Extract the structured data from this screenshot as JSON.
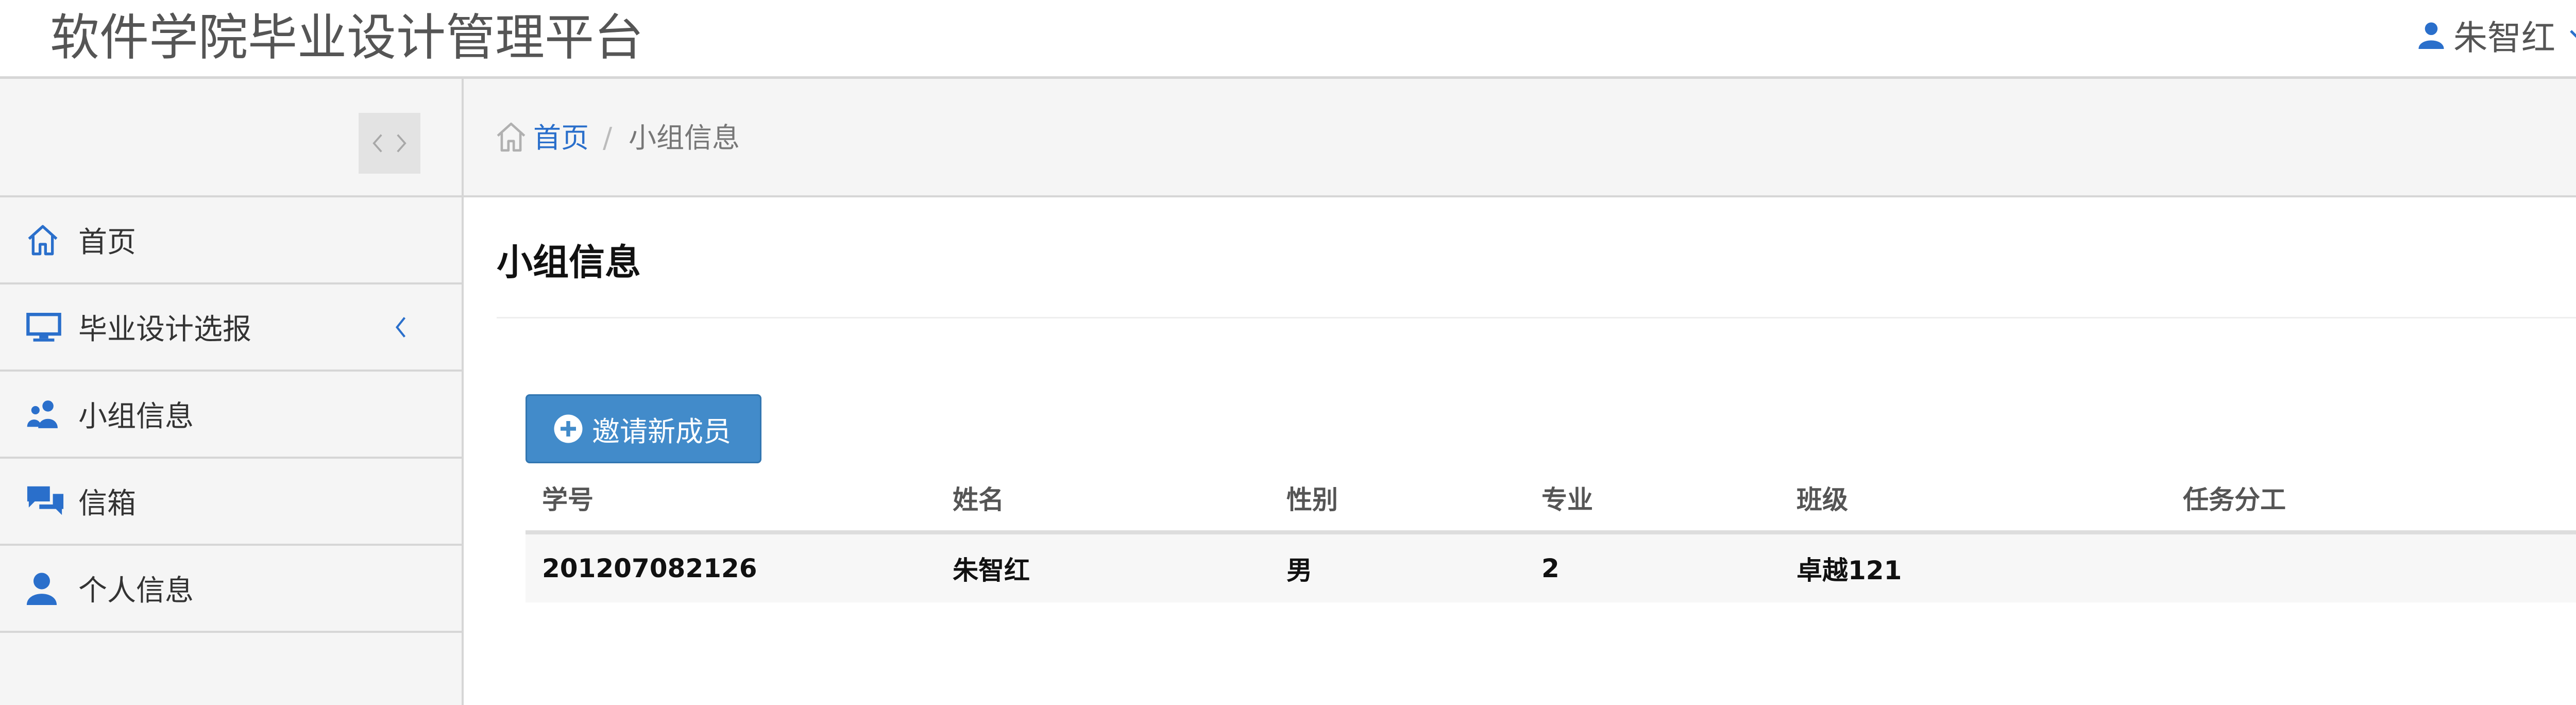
{
  "header": {
    "app_title": "软件学院毕业设计管理平台",
    "user_name": "朱智红"
  },
  "sidebar": {
    "items": [
      {
        "label": "首页",
        "icon": "home-icon"
      },
      {
        "label": "毕业设计选报",
        "icon": "monitor-icon",
        "expandable": true
      },
      {
        "label": "小组信息",
        "icon": "users-icon"
      },
      {
        "label": "信箱",
        "icon": "chat-icon"
      },
      {
        "label": "个人信息",
        "icon": "user-icon"
      }
    ]
  },
  "breadcrumb": {
    "home": "首页",
    "separator": "/",
    "current": "小组信息"
  },
  "main": {
    "title": "小组信息",
    "invite_button": "邀请新成员",
    "table": {
      "headers": [
        "学号",
        "姓名",
        "性别",
        "专业",
        "班级",
        "任务分工"
      ],
      "rows": [
        [
          "201207082126",
          "朱智红",
          "男",
          "2",
          "卓越121",
          ""
        ]
      ]
    }
  },
  "colors": {
    "accent": "#2a6fcb",
    "button": "#428bca",
    "sidebar_bg": "#f5f5f5",
    "border": "#d6d6d6"
  }
}
